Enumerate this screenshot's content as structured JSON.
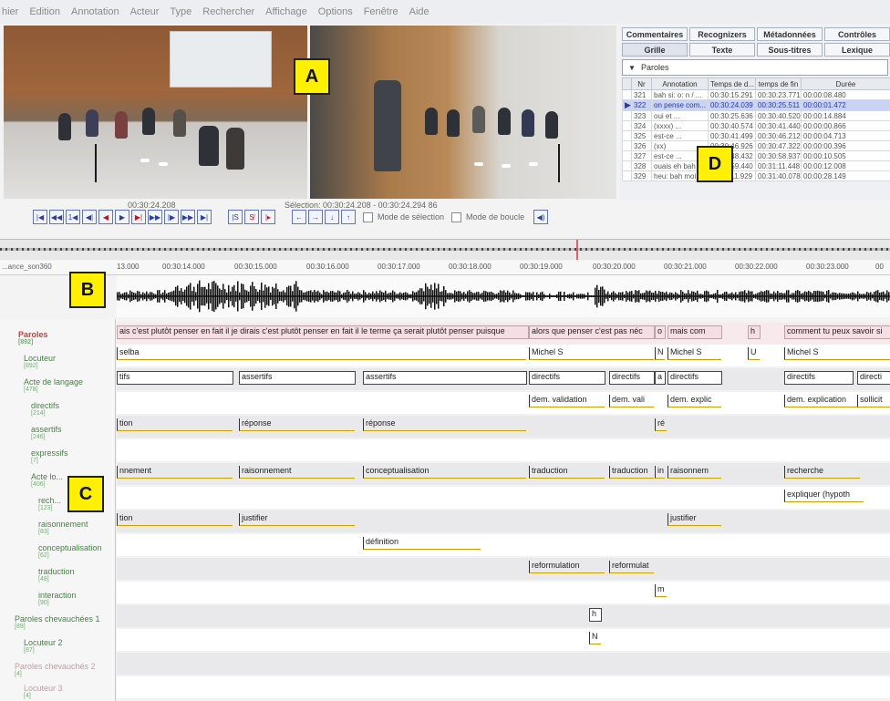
{
  "menu": [
    "hier",
    "Edition",
    "Annotation",
    "Acteur",
    "Type",
    "Rechercher",
    "Affichage",
    "Options",
    "Fenêtre",
    "Aide"
  ],
  "markers": {
    "a": "A",
    "b": "B",
    "c": "C",
    "d": "D"
  },
  "media": {
    "current_time": "00:30:24.208",
    "selection": "Sélection: 00:30:24.208 - 00:30:24.294  86"
  },
  "transport": {
    "buttons": [
      "|◀",
      "◀◀",
      "1◀",
      "◀|",
      "◀",
      "▶",
      "▶|",
      "▶▶",
      "|▶",
      "▶▶",
      "▶|"
    ],
    "sel_buttons": [
      "|S",
      "S̸",
      "|▸"
    ],
    "nav_buttons": [
      "←",
      "→",
      "↓",
      "↑"
    ],
    "selection_mode": "Mode de sélection",
    "loop_mode": "Mode de boucle"
  },
  "right_panel": {
    "tabs_top": [
      "Commentaires",
      "Recognizers",
      "Métadonnées",
      "Contrôles"
    ],
    "tabs_bottom": [
      "Grille",
      "Texte",
      "Sous-titres",
      "Lexique"
    ],
    "tier": "Paroles",
    "columns": [
      "Nr",
      "Annotation",
      "Temps de d...",
      "temps de fin",
      "Durée"
    ],
    "rows": [
      [
        "321",
        "bah si: o: n / ...",
        "00:30:15.291",
        "00:30:23.771",
        "00:00:08.480"
      ],
      [
        "322",
        "on pense com...",
        "00:30:24.039",
        "00:30:25.511",
        "00:00:01.472"
      ],
      [
        "323",
        "oui et ...",
        "00:30:25.636",
        "00:30:40.520",
        "00:00:14.884"
      ],
      [
        "324",
        "(xxxx) ...",
        "00:30:40.574",
        "00:30:41.440",
        "00:00:00.866"
      ],
      [
        "325",
        "est-ce ...",
        "00:30:41.499",
        "00:30:46.212",
        "00:00:04.713"
      ],
      [
        "326",
        "(xx)",
        "00:30:46.926",
        "00:30:47.322",
        "00:00:00.396"
      ],
      [
        "327",
        "est-ce ...",
        "00:30:48.432",
        "00:30:58.937",
        "00:00:10.505"
      ],
      [
        "328",
        "ouais eh bah ...",
        "00:30:59.440",
        "00:31:11.448",
        "00:00:12.008"
      ],
      [
        "329",
        "heu: bah moi...",
        "00:31:11.929",
        "00:31:40.078",
        "00:00:28.149"
      ]
    ]
  },
  "ruler": {
    "name": "...ance_son360",
    "ticks": [
      "13.000",
      "00:30:14.000",
      "00:30:15.000",
      "00:30:16.000",
      "00:30:17.000",
      "00:30:18.000",
      "00:30:19.000",
      "00:30:20.000",
      "00:30:21.000",
      "00:30:22.000",
      "00:30:23.000",
      "00"
    ]
  },
  "tier_names": [
    {
      "name": "Paroles",
      "count": "[892]"
    },
    {
      "name": "Locuteur",
      "count": "[892]"
    },
    {
      "name": "Acte de langage",
      "count": "[478]"
    },
    {
      "name": "directifs",
      "count": "[214]"
    },
    {
      "name": "assertifs",
      "count": "[246]"
    },
    {
      "name": "expressifs",
      "count": "[7]"
    },
    {
      "name": "Acte lo...",
      "count": "[406]"
    },
    {
      "name": "rech...",
      "count": "[123]"
    },
    {
      "name": "raisonnement",
      "count": "[83]"
    },
    {
      "name": "conceptualisation",
      "count": "[62]"
    },
    {
      "name": "traduction",
      "count": "[48]"
    },
    {
      "name": "interaction",
      "count": "[90]"
    },
    {
      "name": "Paroles chevauchées 1",
      "count": "[89]"
    },
    {
      "name": "Locuteur 2",
      "count": "[87]"
    },
    {
      "name": "Paroles chevauchés 2",
      "count": "[4]"
    },
    {
      "name": "Locuteur 3",
      "count": "[4]"
    }
  ],
  "annotations": {
    "paroles": [
      "ais c'est plutôt penser en fait il je dirais c'est plutôt penser en fait il le terme ça serait plutôt penser puisque",
      "alors que penser c'est pas néc",
      "o",
      "mais com",
      "h",
      "comment tu peux savoir si"
    ],
    "locuteur": [
      "selba",
      "Michel S",
      "N",
      "Michel S",
      "U",
      "Michel S"
    ],
    "acte_langage": [
      "tifs",
      "assertifs",
      "assertifs",
      "directifs",
      "directifs",
      "a",
      "directifs",
      "directifs",
      "directi"
    ],
    "directifs": [
      "dem. validation",
      "dem. vali",
      "dem. explic",
      "dem. explication",
      "sollicit"
    ],
    "assertifs": [
      "tion",
      "réponse",
      "réponse",
      "ré"
    ],
    "acte_lo": [
      "nnement",
      "raisonnement",
      "conceptualisation",
      "traduction",
      "traduction",
      "in",
      "raisonnem",
      "recherche"
    ],
    "recherche": [
      "expliquer (hypoth"
    ],
    "raisonnement": [
      "tion",
      "justifier",
      "justifier"
    ],
    "conceptualisation": [
      "définition"
    ],
    "traduction": [
      "reformulation",
      "reformulat"
    ],
    "interaction": [
      "m"
    ],
    "chevauchees1": [
      "h"
    ],
    "locuteur2": [
      "N"
    ]
  }
}
